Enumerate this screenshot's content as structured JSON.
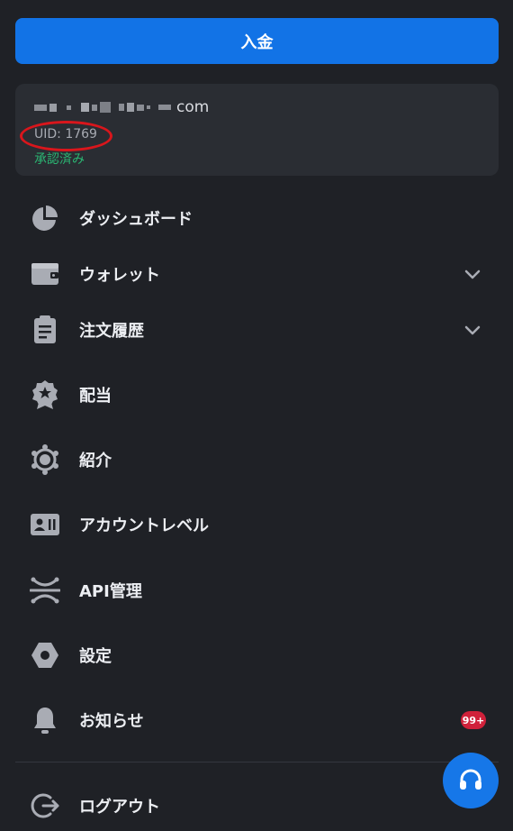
{
  "deposit": {
    "label": "入金"
  },
  "account": {
    "email_suffix": "com",
    "uid": "UID: 1769",
    "status": "承認済み"
  },
  "menu": [
    {
      "label": "ダッシュボード",
      "icon": "pie-chart-icon"
    },
    {
      "label": "ウォレット",
      "icon": "wallet-icon",
      "expandable": true
    },
    {
      "label": "注文履歴",
      "icon": "clipboard-icon",
      "expandable": true
    },
    {
      "label": "配当",
      "icon": "award-icon"
    },
    {
      "label": "紹介",
      "icon": "referral-icon"
    },
    {
      "label": "アカウントレベル",
      "icon": "id-card-icon"
    },
    {
      "label": "API管理",
      "icon": "api-icon"
    },
    {
      "label": "設定",
      "icon": "hexagon-settings-icon"
    },
    {
      "label": "お知らせ",
      "icon": "bell-icon",
      "badge": "99+"
    },
    {
      "label": "ログアウト",
      "icon": "logout-icon"
    }
  ],
  "colors": {
    "background": "#1f2126",
    "accent": "#1273e6",
    "verified": "#2bb673",
    "badge": "#d0213a",
    "highlight_circle": "#d9161c"
  }
}
